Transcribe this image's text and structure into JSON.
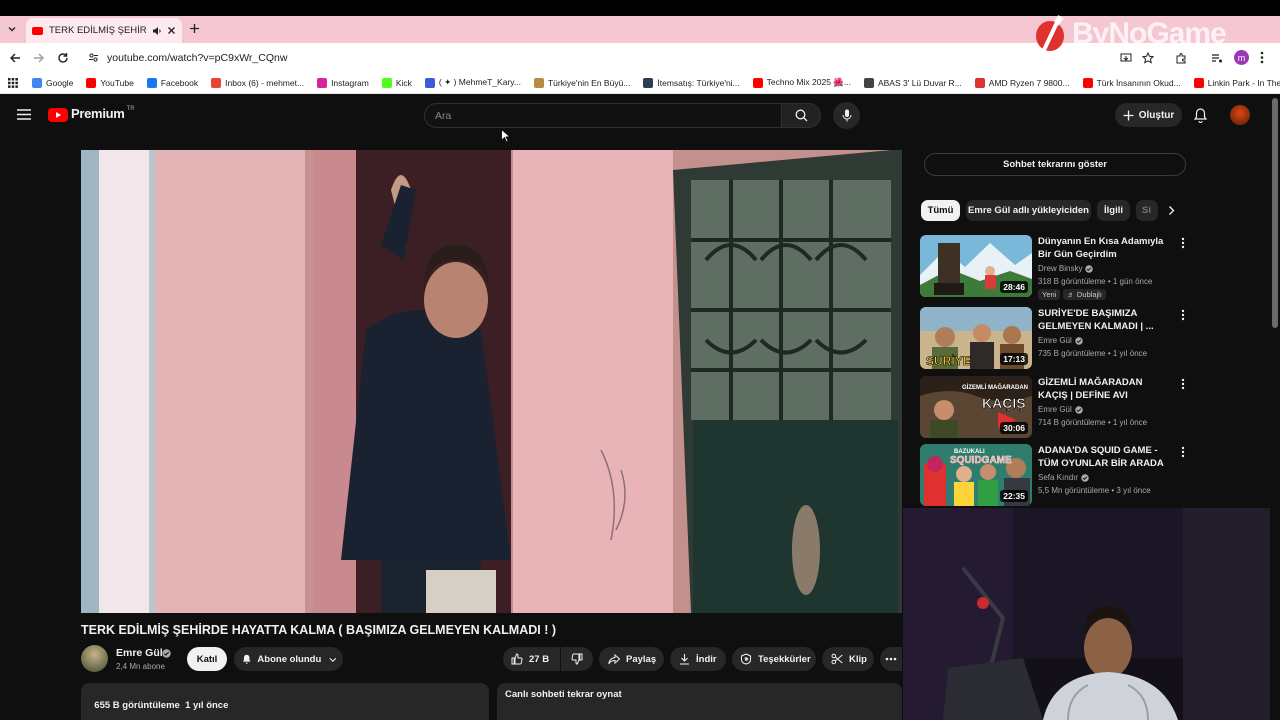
{
  "browser": {
    "tab_title": "TERK EDİLMİŞ ŞEHİRDE HA",
    "url": "youtube.com/watch?v=pC9xWr_CQnw",
    "profile_initial": "m",
    "bookmarks": [
      {
        "label": "Google",
        "color": "#4285f4"
      },
      {
        "label": "YouTube",
        "color": "#ff0000"
      },
      {
        "label": "Facebook",
        "color": "#1877f2"
      },
      {
        "label": "Inbox (6) - mehmet...",
        "color": "#ea4335"
      },
      {
        "label": "Instagram",
        "color": "#d6249f"
      },
      {
        "label": "Kick",
        "color": "#53fc18"
      },
      {
        "label": "( ✦ ) MehmeT_Kary...",
        "color": "#3b5bdb"
      },
      {
        "label": "Türkiye'nin En Büyü...",
        "color": "#b88a44"
      },
      {
        "label": "İtemsatış: Türkiye'ni...",
        "color": "#2d3e50"
      },
      {
        "label": "Techno Mix 2025 🌺...",
        "color": "#ff0000"
      },
      {
        "label": "ABAS 3' Lü Duvar R...",
        "color": "#444444"
      },
      {
        "label": "AMD Ryzen 7 9800...",
        "color": "#e03131"
      },
      {
        "label": "Türk İnsanının Okud...",
        "color": "#ff0000"
      },
      {
        "label": "Linkin Park - In The...",
        "color": "#ff0000"
      }
    ]
  },
  "watermark": "ByNoGame",
  "youtube": {
    "logo_text": "Premium",
    "logo_region": "TR",
    "search_placeholder": "Ara",
    "create_label": "Oluştur",
    "video_title": "TERK EDİLMİŞ ŞEHİRDE HAYATTA KALMA ( BAŞIMIZA GELMEYEN KALMADI ! )",
    "channel_name": "Emre Gül",
    "subscribers": "2,4 Mn abone",
    "join_label": "Katıl",
    "subscribed_label": "Abone olundu",
    "like_count": "27 B",
    "share_label": "Paylaş",
    "download_label": "İndir",
    "thanks_label": "Teşekkürler",
    "clip_label": "Klip",
    "description_meta": "655 B görüntüleme  1 yıl önce",
    "chat_replay_label": "Canlı sohbeti tekrar oynat"
  },
  "sidebar": {
    "show_chat_label": "Sohbet tekrarını göster",
    "chips": [
      "Tümü",
      "Emre Gül adlı yükleyiciden",
      "İlgili",
      "Si"
    ],
    "recommendations": [
      {
        "title": "Dünyanın En Kısa Adamıyla Bir Gün Geçirdim",
        "channel": "Drew Binsky",
        "meta": "318 B görüntüleme • 1 gün önce",
        "duration": "28:46",
        "badges": [
          "Yeni",
          "Dublajlı"
        ]
      },
      {
        "title": "SURİYE'DE BAŞIMIZA GELMEYEN KALMADI | ...",
        "channel": "Emre Gül",
        "meta": "735 B görüntüleme • 1 yıl önce",
        "duration": "17:13",
        "badges": []
      },
      {
        "title": "GİZEMLİ MAĞARADAN KAÇIŞ | DEFİNE AVI",
        "channel": "Emre Gül",
        "meta": "714 B görüntüleme • 1 yıl önce",
        "duration": "30:06",
        "badges": []
      },
      {
        "title": "ADANA'DA SQUID GAME - TÜM OYUNLAR BİR ARADA",
        "channel": "Sefa Kındır",
        "meta": "5,5 Mn görüntüleme • 3 yıl önce",
        "duration": "22:35",
        "badges": []
      }
    ]
  },
  "thumbnail_texts": [
    "SURİYE",
    "GİZEMLİ MAĞARADAN",
    "KAÇIŞ",
    "BAZUKALI",
    "SQUIDGAME"
  ]
}
